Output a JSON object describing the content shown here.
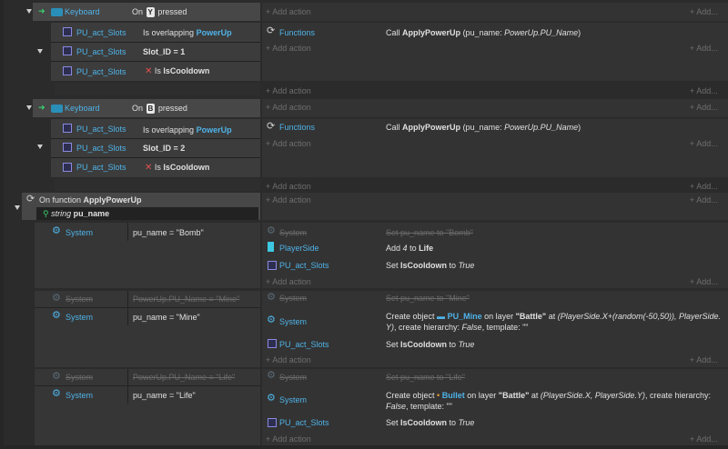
{
  "add_action": "+ Add action",
  "add_short": "+ Add...",
  "events": [
    {
      "trigger": {
        "object": "Keyboard",
        "prefix": "On",
        "key": "Y",
        "suffix": "pressed"
      },
      "sub": {
        "conditions": [
          {
            "object": "PU_act_Slots",
            "text": "Is overlapping",
            "target": "PowerUp"
          },
          {
            "object": "PU_act_Slots",
            "text": "Slot_ID = 1"
          },
          {
            "object": "PU_act_Slots",
            "text": "Is IsCooldown",
            "negated": true
          }
        ],
        "action": {
          "object": "Functions",
          "prefix": "Call",
          "func": "ApplyPowerUp",
          "args": "(pu_name: ",
          "arg_value": "PowerUp.PU_Name",
          "close": ")"
        }
      }
    },
    {
      "trigger": {
        "object": "Keyboard",
        "prefix": "On",
        "key": "B",
        "suffix": "pressed"
      },
      "sub": {
        "conditions": [
          {
            "object": "PU_act_Slots",
            "text": "Is overlapping",
            "target": "PowerUp"
          },
          {
            "object": "PU_act_Slots",
            "text": "Slot_ID = 2"
          },
          {
            "object": "PU_act_Slots",
            "text": "Is IsCooldown",
            "negated": true
          }
        ],
        "action": {
          "object": "Functions",
          "prefix": "Call",
          "func": "ApplyPowerUp",
          "args": "(pu_name: ",
          "arg_value": "PowerUp.PU_Name",
          "close": ")"
        }
      }
    }
  ],
  "function": {
    "prefix": "On function",
    "name": "ApplyPowerUp",
    "param_type": "string",
    "param_name": "pu_name",
    "blocks": [
      {
        "condition": {
          "object": "System",
          "text": "pu_name = \"Bomb\""
        },
        "actions": [
          {
            "object": "System",
            "text": "Set pu_name to \"Bomb\"",
            "disabled": true
          },
          {
            "object": "PlayerSide",
            "pre": "Add",
            "v1": "4",
            "mid": "to",
            "v2": "Life"
          },
          {
            "object": "PU_act_Slots",
            "pre": "Set",
            "v1": "IsCooldown",
            "mid": "to",
            "v2": "True"
          }
        ]
      },
      {
        "disabled_condition": {
          "object": "System",
          "text": "PowerUp.PU_Name = \"Mine\""
        },
        "condition": {
          "object": "System",
          "text": "pu_name = \"Mine\""
        },
        "actions": [
          {
            "object": "System",
            "text": "Set pu_name to \"Mine\"",
            "disabled": true
          },
          {
            "object": "System",
            "line1a": "Create object",
            "line1obj": "PU_Mine",
            "line1b": "on layer",
            "line1layer": "\"Battle\"",
            "line1c": "at",
            "line1pos": "(PlayerSide.X+(random(-50,50)), PlayerSide.",
            "line2pos": "Y)",
            "line2a": ", create hierarchy:",
            "line2v": "False",
            "line2b": ", template: \"\""
          },
          {
            "object": "PU_act_Slots",
            "pre": "Set",
            "v1": "IsCooldown",
            "mid": "to",
            "v2": "True"
          }
        ]
      },
      {
        "disabled_condition": {
          "object": "System",
          "text": "PowerUp.PU_Name = \"Life\""
        },
        "condition": {
          "object": "System",
          "text": "pu_name = \"Life\""
        },
        "actions": [
          {
            "object": "System",
            "text": "Set pu_name to \"Life\"",
            "disabled": true
          },
          {
            "object": "System",
            "line1a": "Create object",
            "line1obj": "Bullet",
            "line1b": "on layer",
            "line1layer": "\"Battle\"",
            "line1c": "at",
            "line1pos": "(PlayerSide.X, PlayerSide.Y)",
            "line1d": ", create hierarchy:",
            "line2v": "False",
            "line2b": ", template: \"\""
          },
          {
            "object": "PU_act_Slots",
            "pre": "Set",
            "v1": "IsCooldown",
            "mid": "to",
            "v2": "True"
          }
        ]
      }
    ]
  }
}
